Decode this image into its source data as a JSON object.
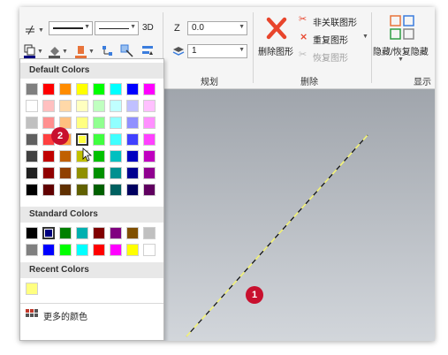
{
  "ribbon": {
    "threed_label": "3D",
    "z_label": "Z",
    "z_value": "0.0",
    "layer_value": "1",
    "group_plan": "规划",
    "delete_shape_label": "删除图形",
    "unrelated_shape_label": "非关联图形",
    "duplicate_shape_label": "重复图形",
    "restore_shape_label": "恢复图形",
    "group_delete": "删除",
    "hide_restore_label": "隐藏/恢复隐藏",
    "group_display": "显示"
  },
  "color_popup": {
    "default_title": "Default Colors",
    "standard_title": "Standard Colors",
    "recent_title": "Recent Colors",
    "more_colors_label": "更多的颜色",
    "default_rows": [
      [
        "#808080",
        "#ff0000",
        "#ff8c00",
        "#ffff00",
        "#00ff00",
        "#00ffff",
        "#0000ff",
        "#ff00ff"
      ],
      [
        "#ffffff",
        "#ffc0c0",
        "#ffd8a8",
        "#ffffc0",
        "#c0ffc0",
        "#c0ffff",
        "#c0c0ff",
        "#ffc0ff"
      ],
      [
        "#c0c0c0",
        "#ff9090",
        "#ffc080",
        "#ffff80",
        "#90ff90",
        "#90ffff",
        "#9090ff",
        "#ff90ff"
      ],
      [
        "#606060",
        "#ff4040",
        "#ffa040",
        "#ffff40",
        "#40ff40",
        "#40ffff",
        "#4040ff",
        "#ff40ff"
      ],
      [
        "#404040",
        "#c00000",
        "#c06000",
        "#c0c000",
        "#00c000",
        "#00c0c0",
        "#0000c0",
        "#c000c0"
      ],
      [
        "#202020",
        "#900000",
        "#904000",
        "#909000",
        "#009000",
        "#009090",
        "#000090",
        "#900090"
      ],
      [
        "#000000",
        "#600000",
        "#603000",
        "#606000",
        "#006000",
        "#006060",
        "#000060",
        "#600060"
      ]
    ],
    "standard_rows": [
      [
        "#000000",
        "#000080",
        "#008000",
        "#00b0b0",
        "#800000",
        "#800080",
        "#805000",
        "#c0c0c0"
      ],
      [
        "#808080",
        "#0000ff",
        "#00ff00",
        "#00ffff",
        "#ff0000",
        "#ff00ff",
        "#ffff00",
        "#ffffff"
      ]
    ],
    "recent": [
      "#ffff80"
    ]
  },
  "badges": {
    "one": "1",
    "two": "2"
  }
}
